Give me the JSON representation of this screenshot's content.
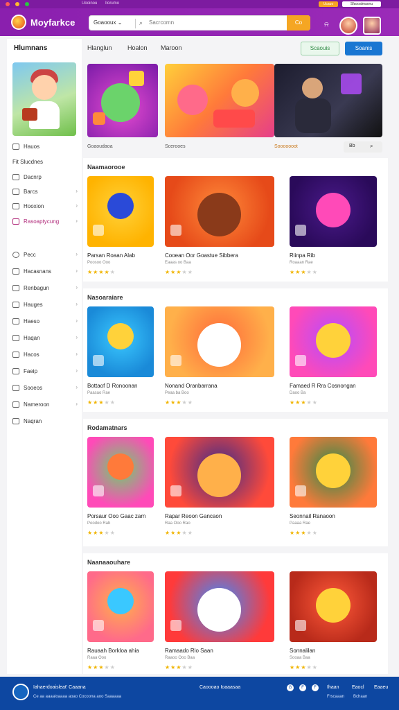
{
  "os_bar": {
    "links": [
      "Uooinou",
      "Ilorumo"
    ],
    "pill_orange": "Ucauo",
    "pill_white": "Sfaooalmaonu"
  },
  "app": {
    "name": "Moyfarkce"
  },
  "search": {
    "category": "Goaooux",
    "category_arrow": "⌄",
    "placeholder": "Sacrcomn",
    "button": "Co"
  },
  "header": {
    "bell_icon": "bell-icon"
  },
  "sidebar": {
    "title": "Hlumnans",
    "items": [
      {
        "label": "Hauos",
        "icon": "gamepad-icon",
        "chevron": ""
      },
      {
        "label": "Fit Slucdnes",
        "icon": "",
        "chevron": ""
      },
      {
        "label": "Dacnrp",
        "icon": "box-icon",
        "chevron": ""
      },
      {
        "label": "Barcs",
        "icon": "grid-icon",
        "chevron": "›"
      },
      {
        "label": "Hooxion",
        "icon": "card-icon",
        "chevron": "›"
      },
      {
        "label": "Rasoaptycung",
        "icon": "tag-icon",
        "chevron": "›",
        "active": true
      }
    ],
    "items2": [
      {
        "label": "Pecc",
        "icon": "circle-icon",
        "chevron": "›"
      },
      {
        "label": "Hacasnans",
        "icon": "clock-icon",
        "chevron": "›"
      },
      {
        "label": "Renbagun",
        "icon": "list-icon",
        "chevron": "›"
      },
      {
        "label": "Hauges",
        "icon": "image-icon",
        "chevron": "›"
      },
      {
        "label": "Haeso",
        "icon": "grid-icon",
        "chevron": "›"
      },
      {
        "label": "Haqan",
        "icon": "doc-icon",
        "chevron": "›"
      },
      {
        "label": "Hacos",
        "icon": "chat-icon",
        "chevron": "›"
      },
      {
        "label": "Faeip",
        "icon": "box-icon",
        "chevron": "›"
      },
      {
        "label": "Sooeos",
        "icon": "gear-icon",
        "chevron": "›"
      },
      {
        "label": "Nameroon",
        "icon": "list-icon",
        "chevron": "›"
      },
      {
        "label": "Naqran",
        "icon": "globe-icon",
        "chevron": ""
      }
    ]
  },
  "tabs": [
    "Hlanglun",
    "Hoalon",
    "Maroon"
  ],
  "actions": {
    "green": "Scaouis",
    "blue": "Soanis"
  },
  "banner_footer": {
    "left": "Goaoudaoa",
    "middle": "Scerooes",
    "right": "Sooooooot",
    "filter": "Bb",
    "search_icon": "search-icon"
  },
  "sections": [
    {
      "title": "Naamaorooe",
      "cards": [
        {
          "title": "Parsan Roaan Alab",
          "sub": "Poosoo Ooo",
          "rating": 4
        },
        {
          "title": "Cooean Oor Goastue Sibbera",
          "sub": "Eaaas oo Baa",
          "rating": 3
        },
        {
          "title": "Riinpa Rib",
          "sub": "Roaaan Rae",
          "rating": 3
        }
      ]
    },
    {
      "title": "Nasoaraiare",
      "cards": [
        {
          "title": "Bottaof D Ronoonan",
          "sub": "Paasao Rae",
          "rating": 3
        },
        {
          "title": "Nonand Oranbarrana",
          "sub": "Peaa ba Boo",
          "rating": 3
        },
        {
          "title": "Famaed R Rra Cosnongan",
          "sub": "Daoo Ba",
          "rating": 3
        }
      ]
    },
    {
      "title": "Rodamatnars",
      "cards": [
        {
          "title": "Porsaur Ooo Gaac zarn",
          "sub": "Poodoo Rab",
          "rating": 3
        },
        {
          "title": "Rapar Reoon Gancaon",
          "sub": "Raa Ooo Rao",
          "rating": 3
        },
        {
          "title": "Seonnail Ranaoon",
          "sub": "Paaaa Rae",
          "rating": 3
        }
      ]
    },
    {
      "title": "Naanaaouhare",
      "cards": [
        {
          "title": "Rauaah Borkloa ahia",
          "sub": "Raaa Ooo",
          "rating": 3
        },
        {
          "title": "Ramaado Rlo Saan",
          "sub": "Raaoo Ooo Baa",
          "rating": 3
        },
        {
          "title": "Sonnalilan",
          "sub": "Sooaa Baa",
          "rating": 3
        }
      ]
    }
  ],
  "footer": {
    "line1": "Iahaerdoaisleat' Caaana",
    "line2": "Ce aa aaaaioaaaa aoao Cocoona aoo Saaaaaa",
    "middle": "Caoooao Ioaaasaa",
    "links": [
      "Ihaan",
      "Eaocl",
      "Eaaeu"
    ],
    "sublinks": [
      "Frscaaan",
      "Bchaan"
    ],
    "social": [
      "G",
      "F",
      "F"
    ]
  },
  "colors": {
    "brand": "#8a1fae",
    "accent": "#f5a623",
    "footer": "#0d47a1",
    "star": "#f0b400"
  }
}
